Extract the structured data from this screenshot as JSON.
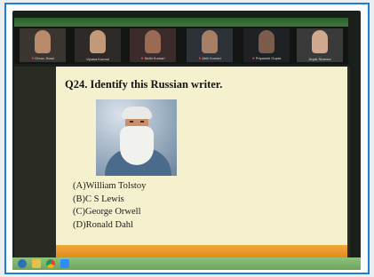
{
  "slide": {
    "question": "Q24. Identify this Russian writer.",
    "options": [
      "(A)William Tolstoy",
      "(B)C S Lewis",
      "(C)George Orwell",
      "(D)Ronald Dahl"
    ]
  },
  "participants": [
    {
      "name": "Dhruv Jhaal",
      "skin": "#b98a6c",
      "bg": "#3a3530"
    },
    {
      "name": "Vipasa Kumari",
      "skin": "#c29a7a",
      "bg": "#2e2a28"
    },
    {
      "name": "Nidhi Kumari",
      "skin": "#9a6b52",
      "bg": "#3b2b2a"
    },
    {
      "name": "Ahili Kumari",
      "skin": "#a77f66",
      "bg": "#2d3138"
    },
    {
      "name": "Priyanshi Gupta",
      "skin": "#7b5b4a",
      "bg": "#1f2224"
    },
    {
      "name": "Anjali Sharma",
      "skin": "#cfa88d",
      "bg": "#3a3a3a"
    }
  ],
  "colors": {
    "frame_border": "#1e7fd0",
    "slide_bg": "#f5f1cf",
    "slide_footer": "#e28a1e",
    "mic_muted": "#ff3b30"
  },
  "icons": [
    "start-orb-icon",
    "file-explorer-icon",
    "chrome-icon",
    "zoom-icon"
  ]
}
